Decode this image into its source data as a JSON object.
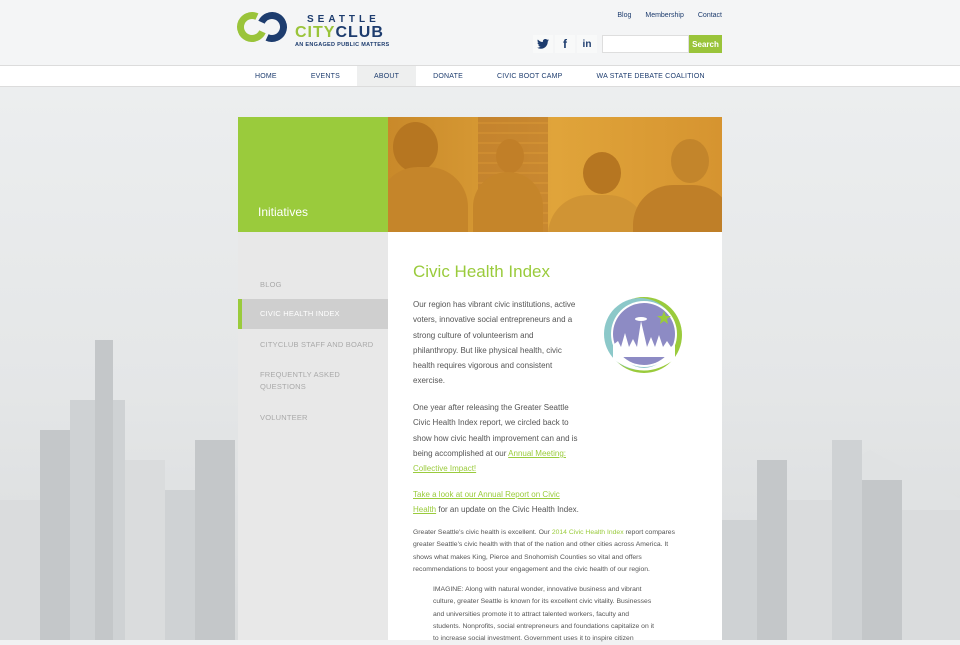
{
  "brand": {
    "line1": "SEATTLE",
    "line2a": "CITY",
    "line2b": "CLUB",
    "tagline": "AN ENGAGED PUBLIC MATTERS",
    "green": "#9acb3c",
    "navy": "#1d3c6e"
  },
  "toplinks": [
    "Blog",
    "Membership",
    "Contact"
  ],
  "social": [
    "twitter-icon",
    "facebook-icon",
    "linkedin-icon"
  ],
  "search": {
    "placeholder": "",
    "button": "Search"
  },
  "nav": [
    "HOME",
    "EVENTS",
    "ABOUT",
    "DONATE",
    "CIVIC BOOT CAMP",
    "WA STATE DEBATE COALITION"
  ],
  "hero": {
    "title": "Initiatives"
  },
  "sidebar": {
    "items": [
      "BLOG",
      "CIVIC HEALTH INDEX",
      "CITYCLUB STAFF AND BOARD",
      "FREQUENTLY ASKED QUESTIONS",
      "VOLUNTEER"
    ],
    "active": "CIVIC HEALTH INDEX"
  },
  "content": {
    "title": "Civic Health Index",
    "p1": [
      "Our region has vibrant civic institutions, active",
      "voters, innovative social entrepreneurs and a",
      "strong culture of volunteerism and",
      "philanthropy. But like physical health, civic",
      "health requires vigorous and consistent",
      "exercise."
    ],
    "p2": [
      "One year after releasing the Greater Seattle",
      "Civic Health Index report, we circled back to",
      "show how civic health improvement can and is",
      "being accomplished at our"
    ],
    "p2_link1": "Annual Meeting:",
    "p2_link2": "Collective Impact!",
    "p3_link1": "Take a look at our Annual Report on Civic",
    "p3_link2": "Health",
    "p3_tail": " for an update on the Civic Health Index.",
    "s1_a": "Greater Seattle's civic health is excellent. Our ",
    "s1_link": "2014 Civic Health Index",
    "s1_b": " report compares",
    "s1_lines": [
      "greater Seattle's civic health with that of the nation and other cities across America. It",
      "shows what makes King, Pierce and Snohomish Counties so vital and offers",
      "recommendations to boost your engagement and the civic health of our region."
    ],
    "quote_lines": [
      "IMAGINE: Along with natural wonder, innovative business and vibrant",
      "culture, greater Seattle is known for its excellent civic vitality. Businesses",
      "and universities promote it to attract talented workers, faculty and",
      "students. Nonprofits, social entrepreneurs and foundations capitalize on it",
      "to increase social investment. Government uses it to inspire citizen"
    ]
  }
}
